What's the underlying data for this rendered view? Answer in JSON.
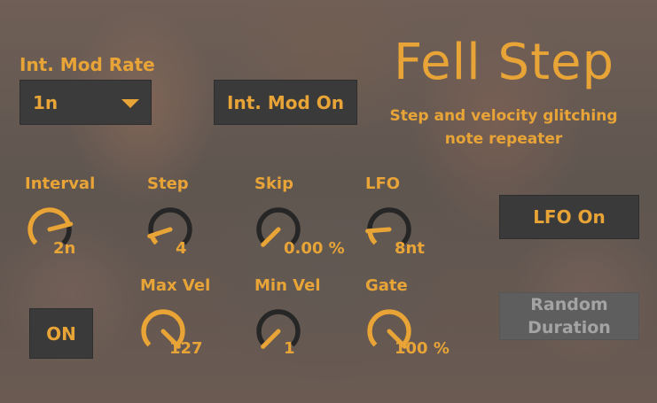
{
  "device": {
    "title": "Fell Step",
    "subtitle_line1": "Step and velocity glitching",
    "subtitle_line2": "note repeater"
  },
  "int_mod_rate": {
    "label": "Int. Mod Rate",
    "value": "1n"
  },
  "int_mod_on_label": "Int. Mod On",
  "on_button_label": "ON",
  "lfo_on_label": "LFO On",
  "random_duration": {
    "line1": "Random",
    "line2": "Duration"
  },
  "knobs": [
    {
      "id": "interval",
      "label": "Interval",
      "value_text": "2n",
      "level": 0.78
    },
    {
      "id": "step",
      "label": "Step",
      "value_text": "4",
      "level": 0.1
    },
    {
      "id": "skip",
      "label": "Skip",
      "value_text": "0.00 %",
      "level": 0.0
    },
    {
      "id": "lfo",
      "label": "LFO",
      "value_text": "8nt",
      "level": 0.15
    },
    {
      "id": "max_vel",
      "label": "Max Vel",
      "value_text": "127",
      "level": 1.0
    },
    {
      "id": "min_vel",
      "label": "Min Vel",
      "value_text": "1",
      "level": 0.0
    },
    {
      "id": "gate",
      "label": "Gate",
      "value_text": "100 %",
      "level": 1.0
    }
  ],
  "colors": {
    "accent": "#e8a436",
    "knob_track": "#262626",
    "button_bg": "#3a3a3a",
    "disabled_bg": "#5e5e5e",
    "disabled_text": "#a4a4a4"
  }
}
